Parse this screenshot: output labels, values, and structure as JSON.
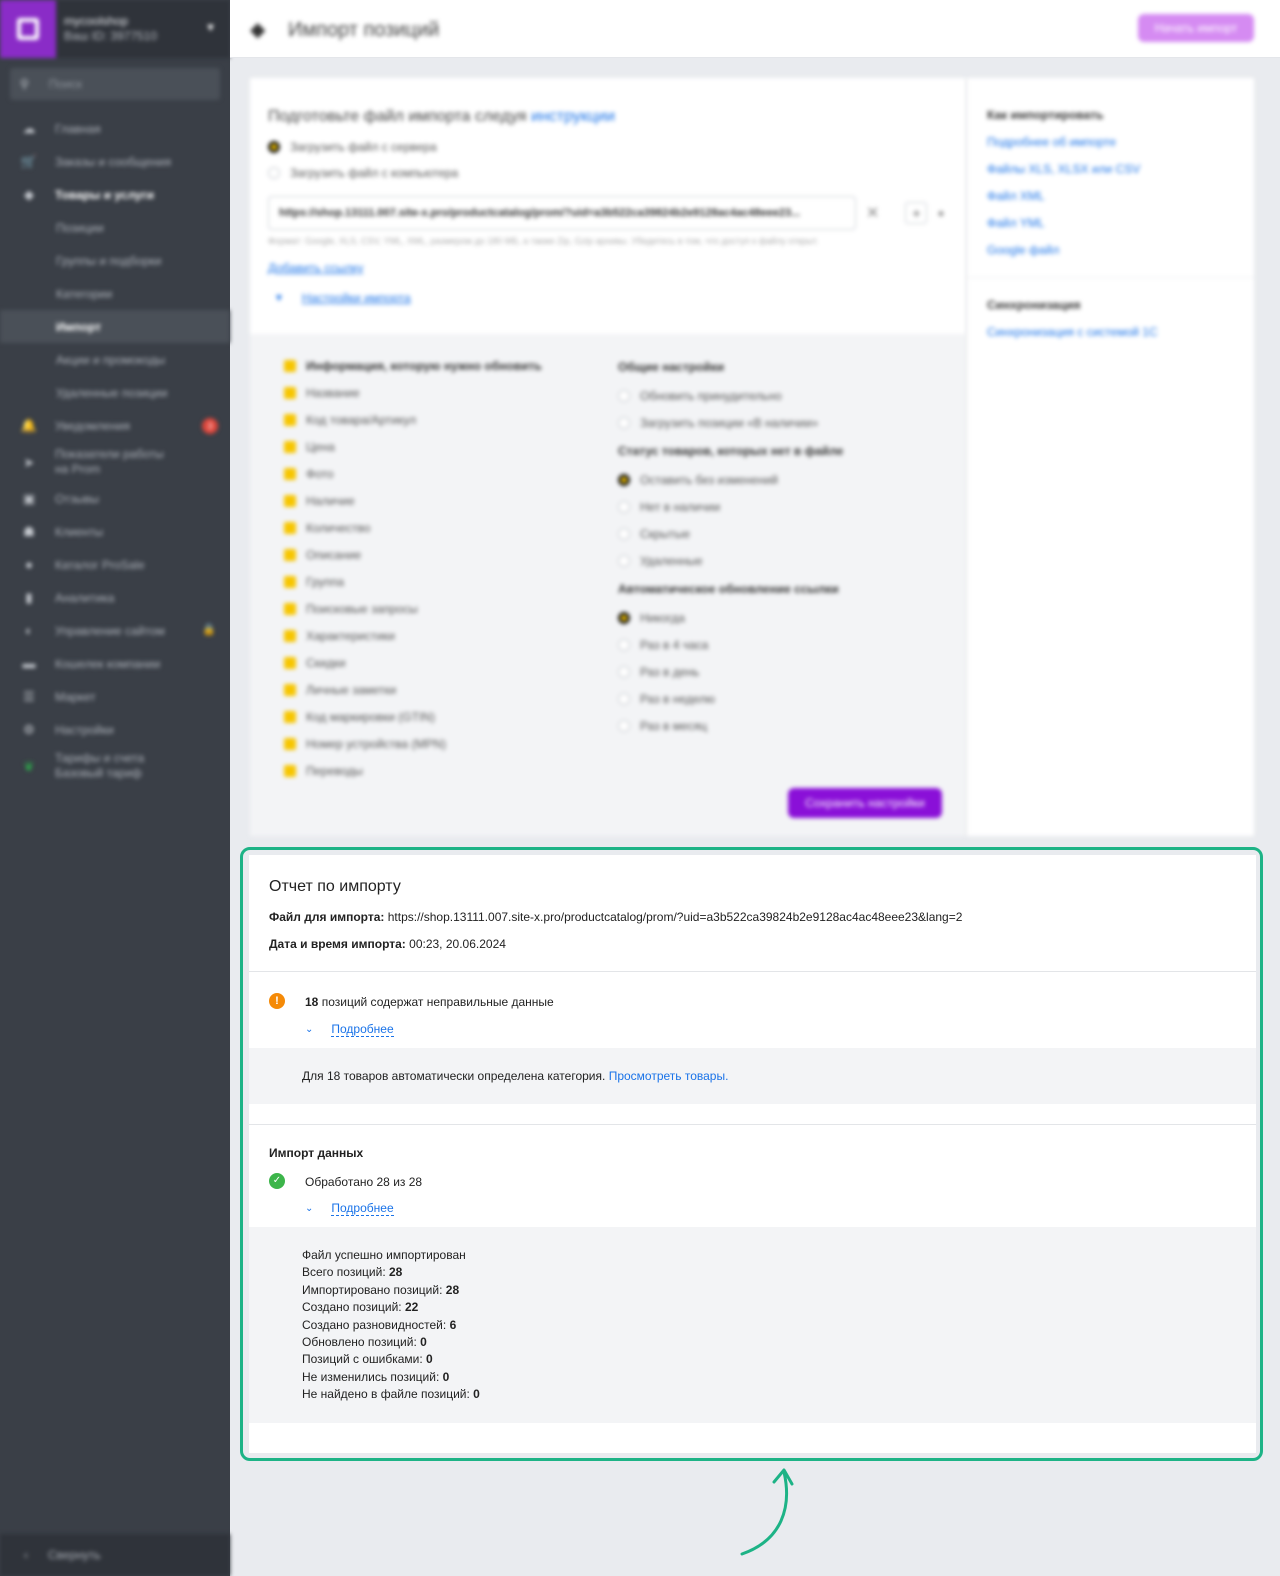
{
  "sidebar": {
    "shop_name": "mycoolshop",
    "shop_id": "Ваш ID: 3977510",
    "search_placeholder": "Поиск",
    "items": [
      {
        "label": "Главная",
        "icon": "home-icon"
      },
      {
        "label": "Заказы и сообщения",
        "icon": "cart-icon"
      },
      {
        "label": "Товары и услуги",
        "icon": "tag-icon"
      },
      {
        "label": "Позиции"
      },
      {
        "label": "Группы и подборки"
      },
      {
        "label": "Категории"
      },
      {
        "label": "Импорт"
      },
      {
        "label": "Акции и промокоды"
      },
      {
        "label": "Удаленные позиции"
      },
      {
        "label": "Уведомления",
        "icon": "bell-icon",
        "badge": "3"
      },
      {
        "label": "Показатели работы",
        "label2": "на Prom",
        "icon": "rocket-icon"
      },
      {
        "label": "Отзывы",
        "icon": "chat-icon"
      },
      {
        "label": "Клиенты",
        "icon": "clients-icon"
      },
      {
        "label": "Каталог ProSale",
        "icon": "catalog-icon"
      },
      {
        "label": "Аналитика",
        "icon": "chart-icon"
      },
      {
        "label": "Управление сайтом",
        "icon": "site-icon"
      },
      {
        "label": "Кошелек компании",
        "icon": "wallet-icon"
      },
      {
        "label": "Маркет",
        "icon": "market-icon"
      },
      {
        "label": "Настройки",
        "icon": "gear-icon"
      },
      {
        "label": "Тарифы и счета",
        "label2": "Базовый тариф",
        "icon": "leaf-icon"
      }
    ],
    "collapse_label": "Свернуть"
  },
  "header": {
    "title": "Импорт позиций",
    "start_button": "Начать импорт"
  },
  "import_form": {
    "instruction_text": "Подготовьте файл импорта следуя",
    "instruction_link": "инструкции",
    "source_server": "Загрузить файл с сервера",
    "source_computer": "Загрузить файл с компьютера",
    "url_value": "https://shop.13111.007.site-x.pro/productcatalog/prom/?uid=a3b522ca39824b2e9128ac4ac48eee23...",
    "hint": "Формат: Google, XLS, CSV, YML, XML, размером до 180 МБ, а также Zip, Gzip архивы. Убедитесь в том, что доступ к файлу открыт.",
    "add_link": "Добавить ссылку",
    "settings_toggle": "Настройки импорта"
  },
  "update_fields": {
    "title": "Информация, которую нужно обновить",
    "items": [
      "Название",
      "Код товара/Артикул",
      "Цена",
      "Фото",
      "Наличие",
      "Количество",
      "Описание",
      "Группа",
      "Поисковые запросы",
      "Характеристики",
      "Скидки",
      "Личные заметки",
      "Код маркировки (GTIN)",
      "Номер устройства (MPN)",
      "Переводы"
    ]
  },
  "general_settings": {
    "title": "Общие настройки",
    "items": [
      "Обновить принудительно",
      "Загрузить позиции «В наличии»"
    ]
  },
  "missing_status": {
    "title": "Статус товаров, которых нет в файле",
    "items": [
      "Оставить без изменений",
      "Нет в наличии",
      "Скрытые",
      "Удаленные"
    ]
  },
  "auto_update": {
    "title": "Автоматическое обновление ссылки",
    "items": [
      "Никогда",
      "Раз в 4 часа",
      "Раз в день",
      "Раз в неделю",
      "Раз в месяц"
    ]
  },
  "save_button": "Сохранить настройки",
  "side": {
    "how_title": "Как импортировать",
    "links": [
      "Подробнее об импорте",
      "Файлы XLS, XLSX или CSV",
      "Файл XML",
      "Файл YML",
      "Google файл"
    ],
    "sync_title": "Синхронизация",
    "sync_link": "Синхронизация с системой 1С"
  },
  "report": {
    "title": "Отчет по импорту",
    "file_label": "Файл для импорта:",
    "file_value": "https://shop.13111.007.site-x.pro/productcatalog/prom/?uid=a3b522ca39824b2e9128ac4ac48eee23&lang=2",
    "date_label": "Дата и время импорта:",
    "date_value": "00:23, 20.06.2024",
    "warn_count": "18",
    "warn_text": "позиций содержат неправильные данные",
    "more_label": "Подробнее",
    "category_text": "Для 18 товаров автоматически определена категория.",
    "category_link": "Просмотреть товары.",
    "data_title": "Импорт данных",
    "processed": "Обработано 28 из 28",
    "more_label2": "Подробнее",
    "success": "Файл успешно импортирован",
    "stats": [
      {
        "label": "Всего позиций:",
        "value": "28"
      },
      {
        "label": "Импортировано позиций:",
        "value": "28"
      },
      {
        "label": "Создано позиций:",
        "value": "22"
      },
      {
        "label": "Создано разновидностей:",
        "value": "6"
      },
      {
        "label": "Обновлено позиций:",
        "value": "0"
      },
      {
        "label": "Позиций с ошибками:",
        "value": "0"
      },
      {
        "label": "Не изменились позиций:",
        "value": "0"
      },
      {
        "label": "Не найдено в файле позиций:",
        "value": "0"
      }
    ]
  },
  "colors": {
    "highlight": "#1db386",
    "accent": "#8a10d8",
    "link": "#1a73e8",
    "warning": "#f58a07",
    "success": "#3cb54a"
  }
}
